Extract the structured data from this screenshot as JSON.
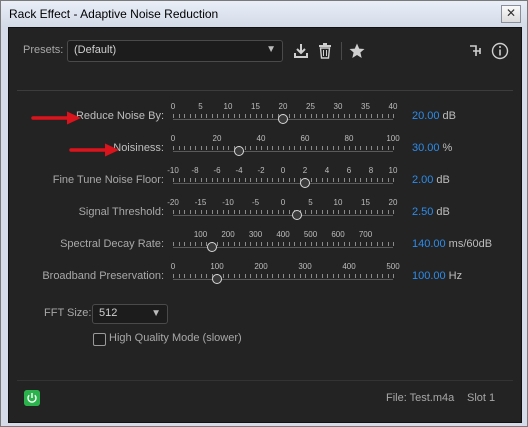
{
  "window": {
    "title": "Rack Effect - Adaptive Noise Reduction",
    "close_label": "✕"
  },
  "header": {
    "presets_label": "Presets:",
    "presets_value": "(Default)",
    "icons": [
      "save-preset-icon",
      "delete-preset-icon",
      "favorite-star-icon",
      "routing-icon",
      "info-icon"
    ]
  },
  "controls": [
    {
      "id": "reduce",
      "label": "Reduce Noise By:",
      "ticks": [
        "0",
        "5",
        "10",
        "15",
        "20",
        "25",
        "30",
        "35",
        "40"
      ],
      "value": 20,
      "min": 0,
      "max": 40,
      "display": "20.00",
      "unit": "dB"
    },
    {
      "id": "noisiness",
      "label": "Noisiness:",
      "ticks": [
        "0",
        "20",
        "40",
        "60",
        "80",
        "100"
      ],
      "value": 30,
      "min": 0,
      "max": 100,
      "display": "30.00",
      "unit": "%"
    },
    {
      "id": "finetune",
      "label": "Fine Tune Noise Floor:",
      "ticks": [
        "-10",
        "-8",
        "-6",
        "-4",
        "-2",
        "0",
        "2",
        "4",
        "6",
        "8",
        "10"
      ],
      "value": 2,
      "min": -10,
      "max": 10,
      "display": "2.00",
      "unit": "dB"
    },
    {
      "id": "threshold",
      "label": "Signal Threshold:",
      "ticks": [
        "-20",
        "-15",
        "-10",
        "-5",
        "0",
        "5",
        "10",
        "15",
        "20"
      ],
      "value": 2.5,
      "min": -20,
      "max": 20,
      "display": "2.50",
      "unit": "dB"
    },
    {
      "id": "decay",
      "label": "Spectral Decay Rate:",
      "ticks": [
        "100",
        "200",
        "300",
        "400",
        "500",
        "600",
        "700"
      ],
      "value": 140,
      "min": 0,
      "max": 800,
      "display": "140.00",
      "unit": "ms/60dB",
      "tick_values": [
        100,
        200,
        300,
        400,
        500,
        600,
        700
      ]
    },
    {
      "id": "broadband",
      "label": "Broadband Preservation:",
      "ticks": [
        "0",
        "100",
        "200",
        "300",
        "400",
        "500"
      ],
      "value": 100,
      "min": 0,
      "max": 500,
      "display": "100.00",
      "unit": "Hz"
    }
  ],
  "fft": {
    "label": "FFT Size:",
    "value": "512"
  },
  "high_quality": {
    "label": "High Quality Mode (slower)",
    "checked": false
  },
  "footer": {
    "file": "File: Test.m4a",
    "slot": "Slot 1"
  },
  "colors": {
    "accent": "#2d8ceb",
    "annotation_arrow": "#d9141c",
    "power": "#2bb24c"
  }
}
